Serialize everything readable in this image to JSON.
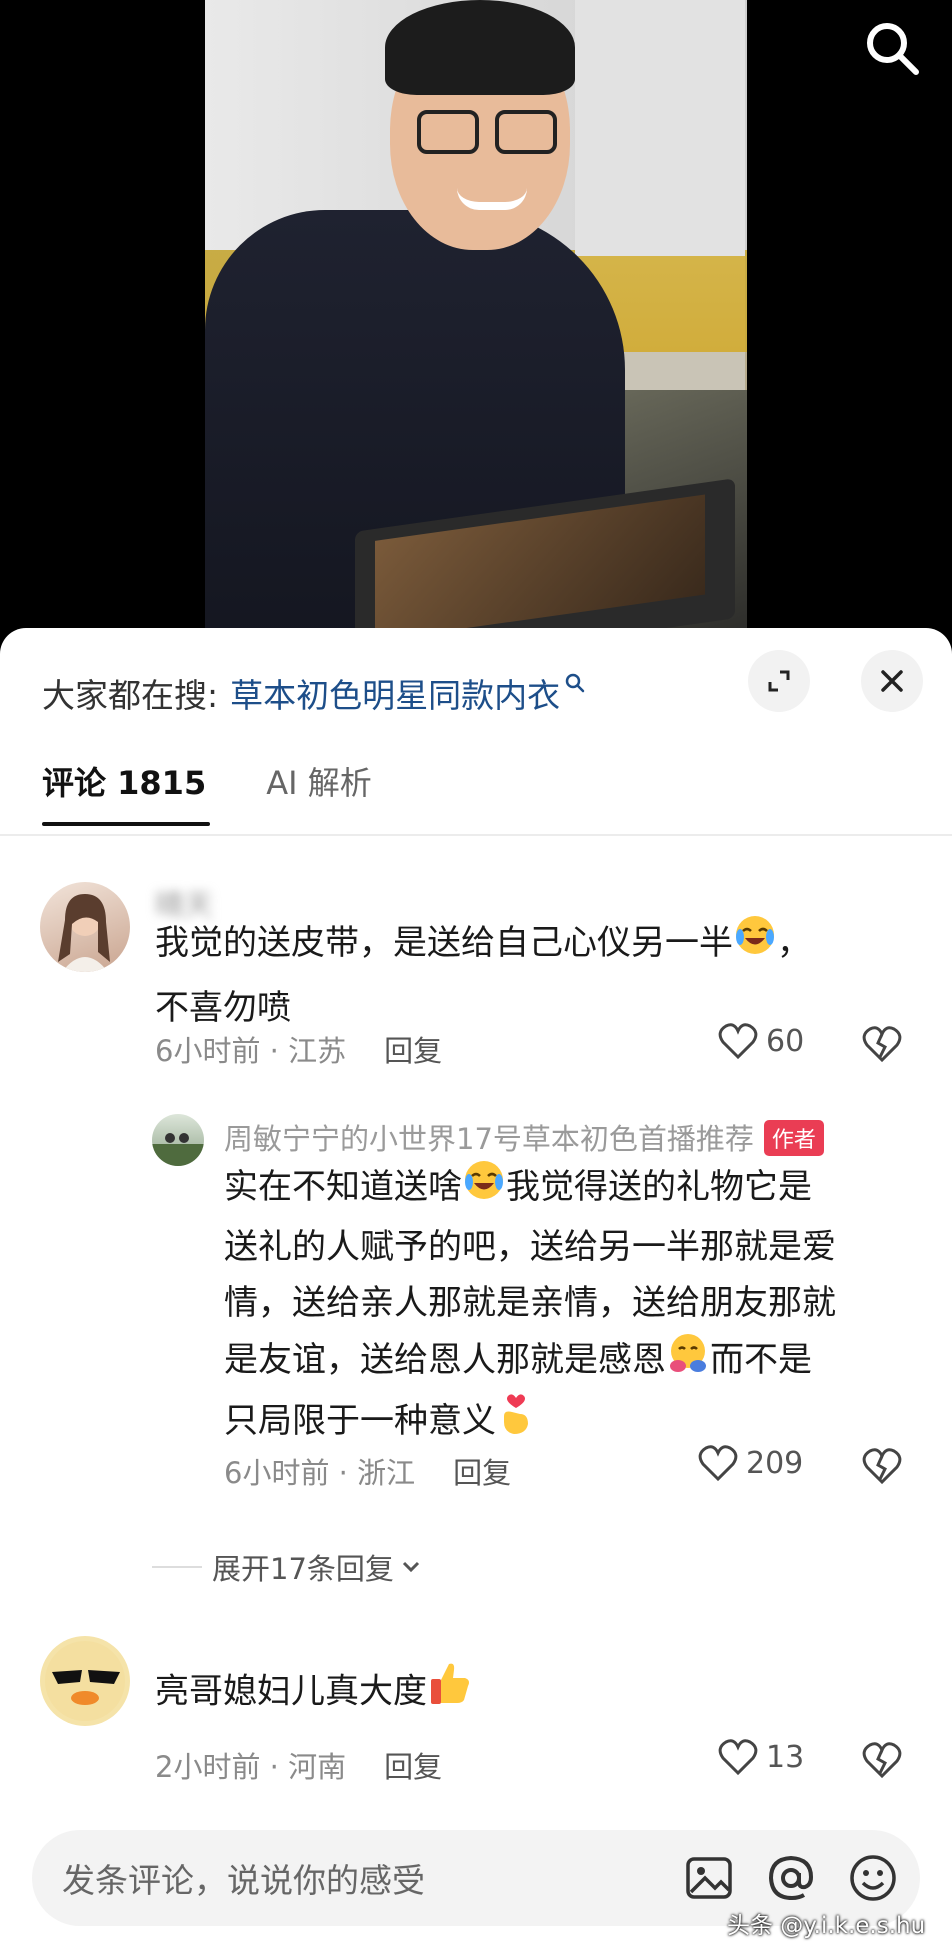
{
  "hot_search": {
    "prefix": "大家都在搜:",
    "term": "草本初色明星同款内衣"
  },
  "tabs": [
    {
      "label": "评论 1815",
      "active": true
    },
    {
      "label": "AI 解析",
      "active": false
    }
  ],
  "comments": [
    {
      "username": "晴天",
      "text_line1": "我觉的送皮带，是送给自己心仪另一半",
      "text_line1_tail": "，",
      "text_line2": "不喜勿喷",
      "time": "6小时前 · 江苏",
      "reply_label": "回复",
      "likes": "60"
    },
    {
      "username": "周敏宁宁的小世界17号草本初色首播推荐",
      "badge": "作者",
      "line1_a": "实在不知道送啥",
      "line1_b": "我觉得送的礼物它是",
      "line2": "送礼的人赋予的吧，送给另一半那就是爱",
      "line3": "情，送给亲人那就是亲情，送给朋友那就",
      "line4_a": "是友谊，送给恩人那就是感恩",
      "line4_b": "而不是",
      "line5": "只局限于一种意义",
      "time": "6小时前 · 浙江",
      "reply_label": "回复",
      "likes": "209"
    },
    {
      "username": "",
      "text": "亮哥媳妇儿真大度",
      "time": "2小时前 · 河南",
      "reply_label": "回复",
      "likes": "13"
    }
  ],
  "expand_replies": "展开17条回复",
  "input": {
    "placeholder": "发条评论，说说你的感受"
  },
  "watermark": "头条 @y.i.k.e.s.hu",
  "colors": {
    "link_blue": "#1d4e89",
    "author_badge": "#ea3d54",
    "muted": "#8a8a8a"
  }
}
